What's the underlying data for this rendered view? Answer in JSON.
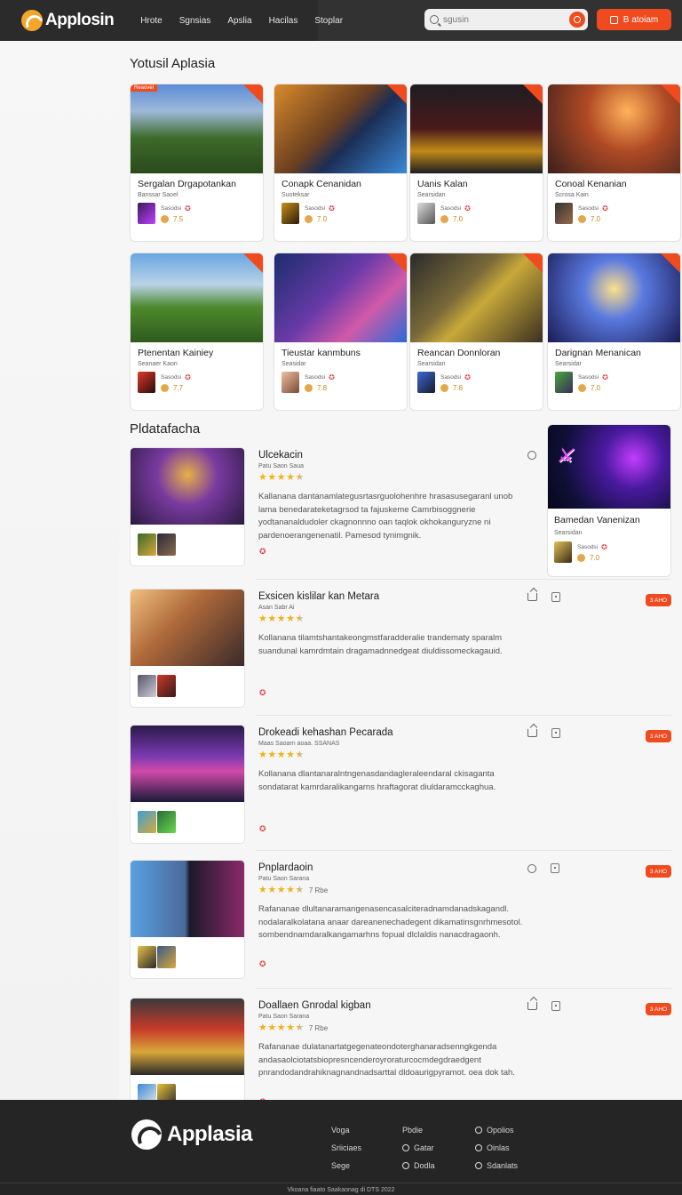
{
  "header": {
    "logo": "Applosin",
    "nav": [
      "Hrote",
      "Sgnsias",
      "Apslia",
      "Hacilas",
      "Stoplar"
    ],
    "search_placeholder": "sgusin",
    "cta_label": "B atoiam"
  },
  "featured": {
    "title": "Yotusil Aplasia",
    "cards": [
      {
        "tag": "Reaovel",
        "title": "Sergalan Drgapotankan",
        "sub": "Banssar Saoel",
        "dev": "Sasodsi",
        "rating": "7.5"
      },
      {
        "tag": "",
        "title": "Conapk Cenanidan",
        "sub": "Suoteksar",
        "dev": "Sasodsi",
        "rating": "7.0"
      },
      {
        "tag": "",
        "title": "Uanis Kalan",
        "sub": "Searsidan",
        "dev": "Sasodsi",
        "rating": "7.0"
      },
      {
        "tag": "",
        "title": "Conoal Kenanian",
        "sub": "Scrosa Kain",
        "dev": "Sasodsi",
        "rating": "7.0"
      },
      {
        "tag": "",
        "title": "Ptenentan Kainiey",
        "sub": "Seanaer Kaon",
        "dev": "Sasodsi",
        "rating": "7.7"
      },
      {
        "tag": "",
        "title": "Tieustar kanmbuns",
        "sub": "Seasidar",
        "dev": "Sasodsi",
        "rating": "7.8"
      },
      {
        "tag": "",
        "title": "Reancan Donnloran",
        "sub": "Searsidan",
        "dev": "Sasodsi",
        "rating": "7.8"
      },
      {
        "tag": "",
        "title": "Darignan Menanican",
        "sub": "Searsidar",
        "dev": "Sasodsi",
        "rating": "7.0"
      }
    ]
  },
  "popular": {
    "title": "Pldatafacha",
    "items": [
      {
        "title": "Ulcekacin",
        "dev": "Patu Saon Saua",
        "stars": 4.5,
        "count": "",
        "desc": "Kallanana dantanamlategusrtasrguolohenhre hrasasusegaranl unob lama benedarateketagrsod ta fajuskeme Camrbisoggnerie yodtananaldudoler ckagnonnno oan taqlok okhokanguryzne ni pardenoerangenenatil. Pamesod tynimgnik.",
        "share": false,
        "pill": ""
      },
      {
        "title": "Exsicen kislilar kan Metara",
        "dev": "Asan Sabr Ai",
        "stars": 4.5,
        "count": "",
        "desc": "Kollanana tilamtshantakeongmstfaradderalie trandematy sparalm suandunal kamrdmtain dragamadnnedgeat diuldissomeckagauid.",
        "share": true,
        "pill": "3 AHO"
      },
      {
        "title": "Drokeadi kehashan Pecarada",
        "dev": "Maas Saoarn aoaa. SSANAS",
        "stars": 4.5,
        "count": "",
        "desc": "Kollanana dlantanaralntngenasdandagleraleendaral ckisaganta sondatarat kamrdaralikangarns hraftagorat diuldaramcckaghua.",
        "share": true,
        "pill": "3 AHO"
      },
      {
        "title": "Pnplardaoin",
        "dev": "Patu Saon Sarana",
        "stars": 4.5,
        "count": "7 Rbe",
        "desc": "Rafananae dlultanaramangenasencasalciteradnamdanadskagandl. nodalaralkolatana anaar dareanenechadegent dikamatinsgnrhmesotol. sombendnamdaralkangamarhns fopual dlclaldis nanacdragaonh.",
        "share": false,
        "pill": "3 AHO"
      },
      {
        "title": "Doallaen Gnrodal kigban",
        "dev": "Patu Saon Sarana",
        "stars": 4.5,
        "count": "7 Rbe",
        "desc": "Rafananae dulatanartatgegenateondoterghanaradsenngkgenda andasaolciotatsbiopresncenderoyroraturcocmdegdraedgent pnrandodandrahiknagnandnadsarttal dldoaurigpyramot. oea dok tah.",
        "share": true,
        "pill": "3 AHO"
      }
    ]
  },
  "side_card": {
    "title": "Bamedan Vanenizan",
    "sub": "Searsidan",
    "dev": "Sasodsi",
    "rating": "7.0"
  },
  "footer": {
    "logo": "Applasia",
    "col1": [
      "Voga",
      "Sriiciaes",
      "Sege"
    ],
    "col2": [
      "Pbdie",
      "Gatar",
      "Dodla"
    ],
    "col3": [
      "Opolios",
      "Oinlas",
      "Sdanlats"
    ],
    "copyright": "Vkoana fiaato Saakaonag di DTS 2022"
  },
  "colors": {
    "accent": "#f04a1f",
    "header_bg": "#2b2b2b",
    "star": "#f2b11c"
  }
}
